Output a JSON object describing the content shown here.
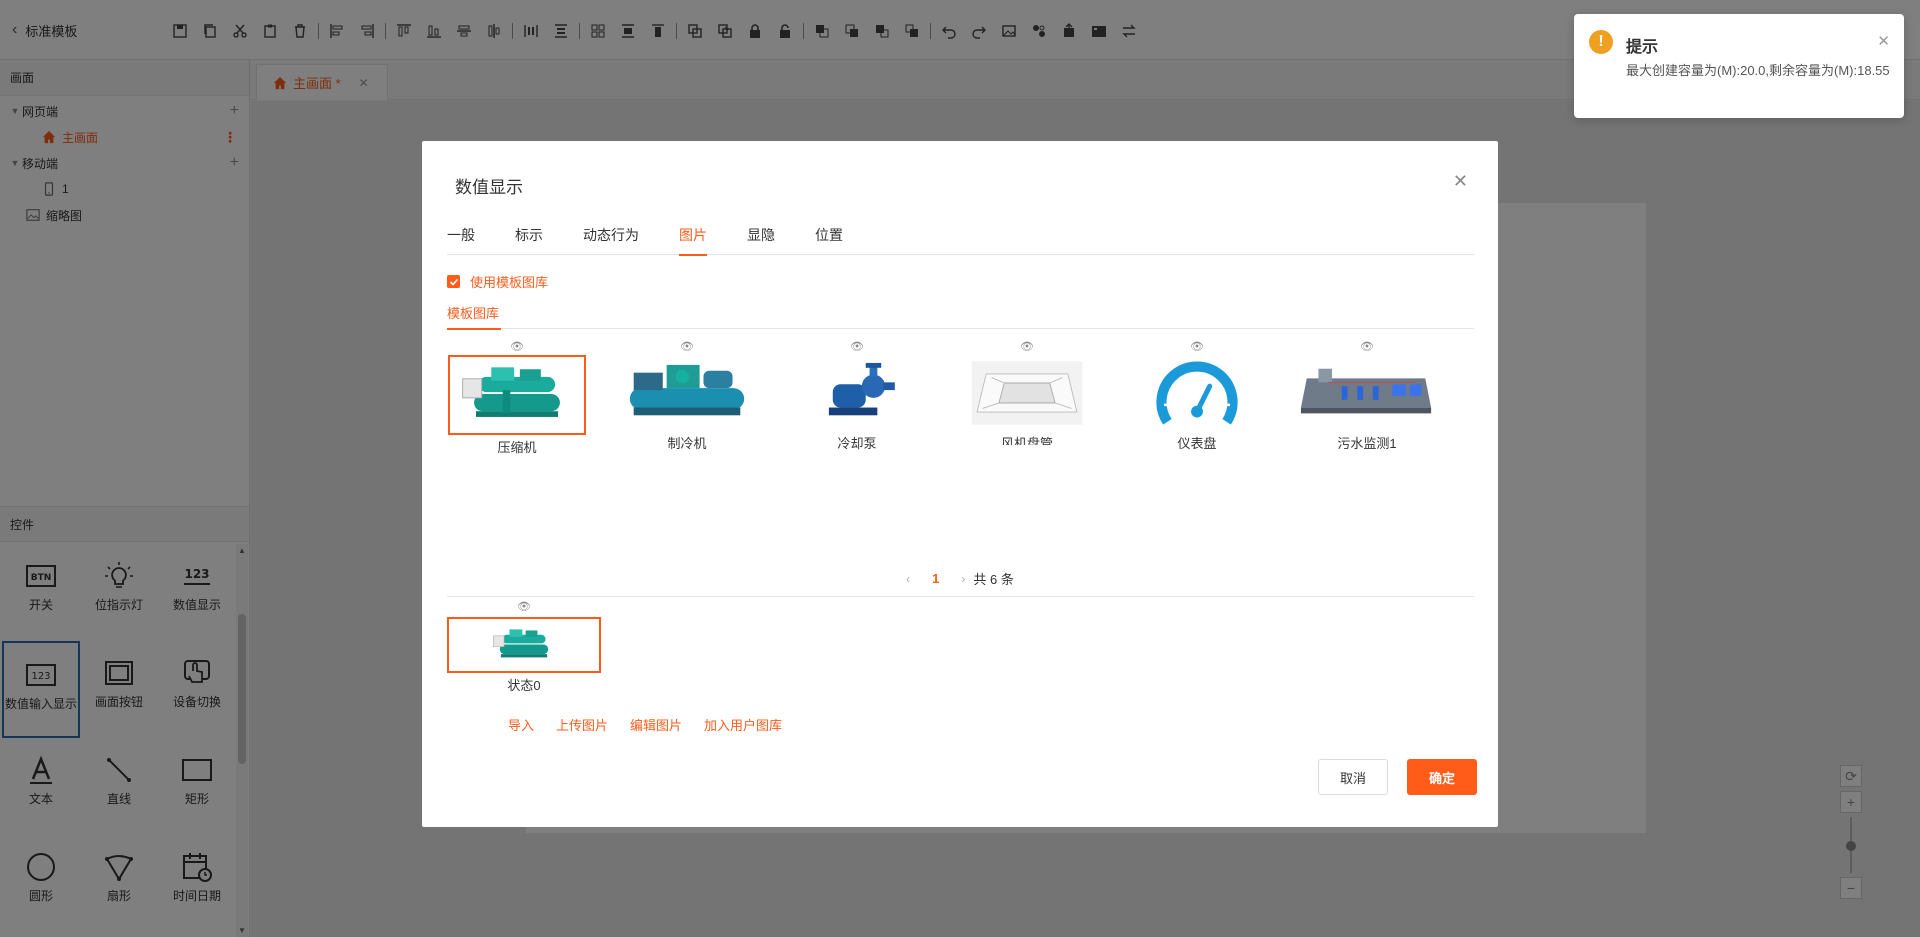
{
  "app": {
    "back_label": "标准模板"
  },
  "toolbar": {
    "icons": [
      "save-icon",
      "copy-icon",
      "cut-icon",
      "paste-icon",
      "delete-icon",
      "align-left-icon",
      "align-right-icon",
      "align-top-icon",
      "align-bottom-icon",
      "align-center-h-icon",
      "align-center-v-icon",
      "distribute-h-icon",
      "distribute-v-icon",
      "group-icon",
      "same-size-icon",
      "same-width-icon",
      "bring-front-icon",
      "send-back-icon",
      "lock-icon",
      "unlock-icon",
      "layer-up-icon",
      "layer-down-icon",
      "layer-top-icon",
      "layer-bottom-icon",
      "undo-icon",
      "redo-icon",
      "image-icon",
      "component-icon",
      "export-icon",
      "record-icon",
      "swap-icon"
    ]
  },
  "left": {
    "pages_header": "画面",
    "tree": {
      "web": "网页端",
      "main_screen": "主画面",
      "mobile": "移动端",
      "mobile_page": "1",
      "thumbnail": "缩略图"
    },
    "controls_header": "控件",
    "controls": [
      {
        "label": "开关",
        "icon": "btn-icon"
      },
      {
        "label": "位指示灯",
        "icon": "bulb-icon"
      },
      {
        "label": "数值显示",
        "icon": "number-display-icon"
      },
      {
        "label": "数值输入显示",
        "icon": "number-input-icon"
      },
      {
        "label": "画面按钮",
        "icon": "screen-button-icon"
      },
      {
        "label": "设备切换",
        "icon": "device-switch-icon"
      },
      {
        "label": "文本",
        "icon": "text-icon"
      },
      {
        "label": "直线",
        "icon": "line-icon"
      },
      {
        "label": "矩形",
        "icon": "rectangle-icon"
      },
      {
        "label": "圆形",
        "icon": "circle-icon"
      },
      {
        "label": "扇形",
        "icon": "sector-icon"
      },
      {
        "label": "时间日期",
        "icon": "datetime-icon"
      }
    ]
  },
  "canvas": {
    "tab_label": "主画面 *"
  },
  "dialog": {
    "title": "数值显示",
    "tabs": [
      "一般",
      "标示",
      "动态行为",
      "图片",
      "显隐",
      "位置"
    ],
    "active_tab": "图片",
    "use_template_label": "使用模板图库",
    "library_tab": "模板图库",
    "gallery": [
      {
        "caption": "压缩机",
        "selected": true
      },
      {
        "caption": "制冷机",
        "selected": false
      },
      {
        "caption": "冷却泵",
        "selected": false
      },
      {
        "caption": "风机盘管",
        "selected": false
      },
      {
        "caption": "仪表盘",
        "selected": false
      },
      {
        "caption": "污水监测1",
        "selected": false
      }
    ],
    "pager": {
      "current": "1",
      "total": "共 6 条"
    },
    "state_caption": "状态0",
    "actions": [
      "导入",
      "上传图片",
      "编辑图片",
      "加入用户图库"
    ],
    "cancel_label": "取消",
    "ok_label": "确定"
  },
  "toast": {
    "title": "提示",
    "message": "最大创建容量为(M):20.0,剩余容量为(M):18.55"
  },
  "colors": {
    "accent": "#ff5c1a",
    "warning": "#f0a020"
  }
}
